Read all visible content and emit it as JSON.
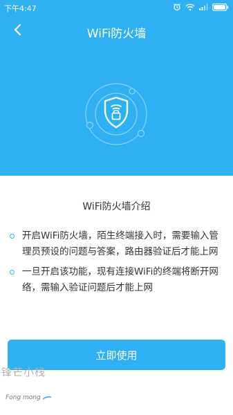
{
  "status": {
    "time": "下午4:47"
  },
  "navbar": {
    "title": "WiFi防火墙"
  },
  "content": {
    "title": "WiFi防火墙介绍",
    "items": [
      "开启WiFi防火墙，陌生终端接入时，需要输入管理员预设的问题与答案，路由器验证后才能上网",
      "一旦开启该功能，现有连接WiFi的终端将断开网络，需输入验证问题后才能上网"
    ]
  },
  "action": {
    "label": "立即使用"
  },
  "watermark": {
    "cn": "锋芒小栈",
    "en": "Fong mong"
  },
  "colors": {
    "accent": "#2eb0f2"
  },
  "icons": [
    "back-arrow-icon",
    "shield-lock-icon",
    "alarm-icon",
    "wifi-icon",
    "signal-icon",
    "battery-icon"
  ]
}
